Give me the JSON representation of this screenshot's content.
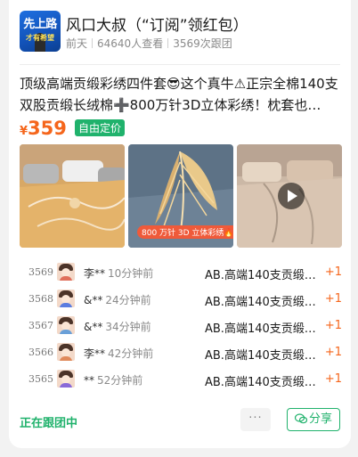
{
  "header": {
    "logo_text": "先上路",
    "logo_subtext": "才有希望",
    "group_title": "风口大叔（“订阅”领红包）",
    "posted": "前天",
    "views": "64640人查看",
    "joined": "3569次跟团"
  },
  "product": {
    "title": "顶级高端贡缎彩绣四件套😎这个真牛⚠正宗全棉140支双股贡缎长绒棉➕800万针3D立体彩绣！枕套也…",
    "price_symbol": "¥",
    "price": "359",
    "price_tag": "自由定价",
    "image_caption": "800 万针 3D 立体彩绣🔥"
  },
  "records": [
    {
      "num": "3569",
      "user": "李**",
      "time": "10分钟前",
      "item": "AB.高端140支贡缎…",
      "qty": "+1",
      "avatar_color": "#e06f5b"
    },
    {
      "num": "3568",
      "user": "&**",
      "time": "24分钟前",
      "item": "AB.高端140支贡缎…",
      "qty": "+1",
      "avatar_color": "#5b7de0"
    },
    {
      "num": "3567",
      "user": "&**",
      "time": "34分钟前",
      "item": "AB.高端140支贡缎…",
      "qty": "+1",
      "avatar_color": "#6aa0d8"
    },
    {
      "num": "3566",
      "user": "李**",
      "time": "42分钟前",
      "item": "AB.高端140支贡缎…",
      "qty": "+1",
      "avatar_color": "#e08a5b"
    },
    {
      "num": "3565",
      "user": "**",
      "time": "52分钟前",
      "item": "AB.高端140支贡缎…",
      "qty": "+1",
      "avatar_color": "#8a6ad8"
    }
  ],
  "footer": {
    "status": "正在跟团中",
    "more_label": "···",
    "share_label": "分享"
  },
  "colors": {
    "accent_orange": "#f5661c",
    "accent_green": "#20b26c"
  }
}
